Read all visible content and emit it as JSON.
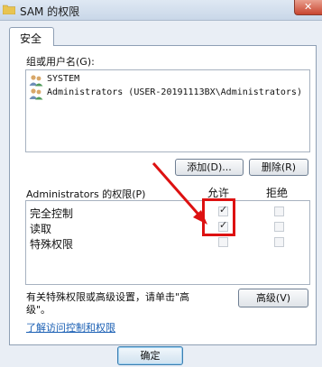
{
  "window": {
    "title": "SAM 的权限"
  },
  "tabs": [
    {
      "label": "安全"
    }
  ],
  "groups": {
    "label": "组或用户名(G):",
    "users": [
      {
        "name": "SYSTEM"
      },
      {
        "name": "Administrators (USER-20191113BX\\Administrators)"
      }
    ]
  },
  "buttons": {
    "add": "添加(D)...",
    "remove": "删除(R)",
    "advanced": "高级(V)",
    "ok": "确定"
  },
  "permissions": {
    "label": "Administrators 的权限(P)",
    "allow_header": "允许",
    "deny_header": "拒绝",
    "rows": [
      {
        "name": "完全控制",
        "allow": true,
        "deny": false
      },
      {
        "name": "读取",
        "allow": true,
        "deny": false
      },
      {
        "name": "特殊权限",
        "allow": false,
        "deny": false
      }
    ]
  },
  "advanced_note": {
    "line1": "有关特殊权限或高级设置，请单击\"高",
    "line2": "级\"。"
  },
  "link": "了解访问控制和权限",
  "colors": {
    "highlight": "#dd1111",
    "link": "#1a5fb4"
  }
}
